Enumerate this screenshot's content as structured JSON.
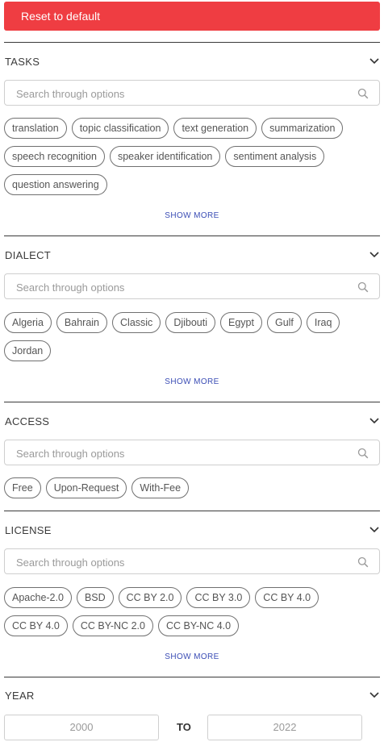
{
  "reset_button_label": "Reset to default",
  "search_placeholder": "Search through options",
  "show_more_label": "SHOW MORE",
  "sections": {
    "tasks": {
      "title": "TASKS",
      "rows": [
        [
          "translation",
          "topic classification",
          "text generation",
          "summarization"
        ],
        [
          "speech recognition",
          "speaker identification",
          "sentiment analysis"
        ],
        [
          "question answering"
        ]
      ]
    },
    "dialect": {
      "title": "DIALECT",
      "rows": [
        [
          "Algeria",
          "Bahrain",
          "Classic",
          "Djibouti",
          "Egypt",
          "Gulf",
          "Iraq"
        ],
        [
          "Jordan"
        ]
      ]
    },
    "access": {
      "title": "ACCESS",
      "rows": [
        [
          "Free",
          "Upon-Request",
          "With-Fee"
        ]
      ]
    },
    "license": {
      "title": "LICENSE",
      "rows": [
        [
          "Apache-2.0",
          "BSD",
          "CC BY 2.0",
          "CC BY 3.0",
          "CC BY 4.0"
        ],
        [
          "CC BY 4.0",
          "CC BY-NC 2.0",
          "CC BY-NC 4.0"
        ]
      ]
    },
    "year": {
      "title": "YEAR",
      "from": "2000",
      "to_label": "TO",
      "to": "2022"
    }
  }
}
